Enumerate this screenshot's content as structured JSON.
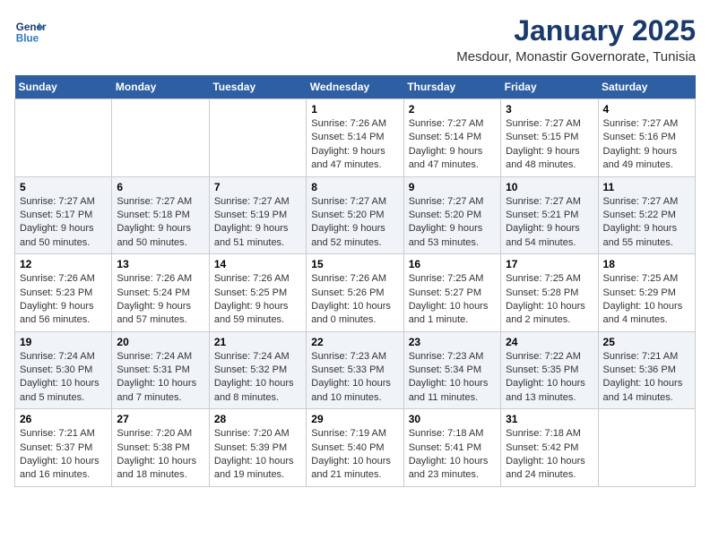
{
  "logo": {
    "general": "General",
    "blue": "Blue"
  },
  "calendar": {
    "title": "January 2025",
    "subtitle": "Mesdour, Monastir Governorate, Tunisia"
  },
  "weekdays": [
    "Sunday",
    "Monday",
    "Tuesday",
    "Wednesday",
    "Thursday",
    "Friday",
    "Saturday"
  ],
  "weeks": [
    [
      {
        "day": null,
        "info": null
      },
      {
        "day": null,
        "info": null
      },
      {
        "day": null,
        "info": null
      },
      {
        "day": "1",
        "info": "Sunrise: 7:26 AM\nSunset: 5:14 PM\nDaylight: 9 hours and 47 minutes."
      },
      {
        "day": "2",
        "info": "Sunrise: 7:27 AM\nSunset: 5:14 PM\nDaylight: 9 hours and 47 minutes."
      },
      {
        "day": "3",
        "info": "Sunrise: 7:27 AM\nSunset: 5:15 PM\nDaylight: 9 hours and 48 minutes."
      },
      {
        "day": "4",
        "info": "Sunrise: 7:27 AM\nSunset: 5:16 PM\nDaylight: 9 hours and 49 minutes."
      }
    ],
    [
      {
        "day": "5",
        "info": "Sunrise: 7:27 AM\nSunset: 5:17 PM\nDaylight: 9 hours and 50 minutes."
      },
      {
        "day": "6",
        "info": "Sunrise: 7:27 AM\nSunset: 5:18 PM\nDaylight: 9 hours and 50 minutes."
      },
      {
        "day": "7",
        "info": "Sunrise: 7:27 AM\nSunset: 5:19 PM\nDaylight: 9 hours and 51 minutes."
      },
      {
        "day": "8",
        "info": "Sunrise: 7:27 AM\nSunset: 5:20 PM\nDaylight: 9 hours and 52 minutes."
      },
      {
        "day": "9",
        "info": "Sunrise: 7:27 AM\nSunset: 5:20 PM\nDaylight: 9 hours and 53 minutes."
      },
      {
        "day": "10",
        "info": "Sunrise: 7:27 AM\nSunset: 5:21 PM\nDaylight: 9 hours and 54 minutes."
      },
      {
        "day": "11",
        "info": "Sunrise: 7:27 AM\nSunset: 5:22 PM\nDaylight: 9 hours and 55 minutes."
      }
    ],
    [
      {
        "day": "12",
        "info": "Sunrise: 7:26 AM\nSunset: 5:23 PM\nDaylight: 9 hours and 56 minutes."
      },
      {
        "day": "13",
        "info": "Sunrise: 7:26 AM\nSunset: 5:24 PM\nDaylight: 9 hours and 57 minutes."
      },
      {
        "day": "14",
        "info": "Sunrise: 7:26 AM\nSunset: 5:25 PM\nDaylight: 9 hours and 59 minutes."
      },
      {
        "day": "15",
        "info": "Sunrise: 7:26 AM\nSunset: 5:26 PM\nDaylight: 10 hours and 0 minutes."
      },
      {
        "day": "16",
        "info": "Sunrise: 7:25 AM\nSunset: 5:27 PM\nDaylight: 10 hours and 1 minute."
      },
      {
        "day": "17",
        "info": "Sunrise: 7:25 AM\nSunset: 5:28 PM\nDaylight: 10 hours and 2 minutes."
      },
      {
        "day": "18",
        "info": "Sunrise: 7:25 AM\nSunset: 5:29 PM\nDaylight: 10 hours and 4 minutes."
      }
    ],
    [
      {
        "day": "19",
        "info": "Sunrise: 7:24 AM\nSunset: 5:30 PM\nDaylight: 10 hours and 5 minutes."
      },
      {
        "day": "20",
        "info": "Sunrise: 7:24 AM\nSunset: 5:31 PM\nDaylight: 10 hours and 7 minutes."
      },
      {
        "day": "21",
        "info": "Sunrise: 7:24 AM\nSunset: 5:32 PM\nDaylight: 10 hours and 8 minutes."
      },
      {
        "day": "22",
        "info": "Sunrise: 7:23 AM\nSunset: 5:33 PM\nDaylight: 10 hours and 10 minutes."
      },
      {
        "day": "23",
        "info": "Sunrise: 7:23 AM\nSunset: 5:34 PM\nDaylight: 10 hours and 11 minutes."
      },
      {
        "day": "24",
        "info": "Sunrise: 7:22 AM\nSunset: 5:35 PM\nDaylight: 10 hours and 13 minutes."
      },
      {
        "day": "25",
        "info": "Sunrise: 7:21 AM\nSunset: 5:36 PM\nDaylight: 10 hours and 14 minutes."
      }
    ],
    [
      {
        "day": "26",
        "info": "Sunrise: 7:21 AM\nSunset: 5:37 PM\nDaylight: 10 hours and 16 minutes."
      },
      {
        "day": "27",
        "info": "Sunrise: 7:20 AM\nSunset: 5:38 PM\nDaylight: 10 hours and 18 minutes."
      },
      {
        "day": "28",
        "info": "Sunrise: 7:20 AM\nSunset: 5:39 PM\nDaylight: 10 hours and 19 minutes."
      },
      {
        "day": "29",
        "info": "Sunrise: 7:19 AM\nSunset: 5:40 PM\nDaylight: 10 hours and 21 minutes."
      },
      {
        "day": "30",
        "info": "Sunrise: 7:18 AM\nSunset: 5:41 PM\nDaylight: 10 hours and 23 minutes."
      },
      {
        "day": "31",
        "info": "Sunrise: 7:18 AM\nSunset: 5:42 PM\nDaylight: 10 hours and 24 minutes."
      },
      {
        "day": null,
        "info": null
      }
    ]
  ]
}
